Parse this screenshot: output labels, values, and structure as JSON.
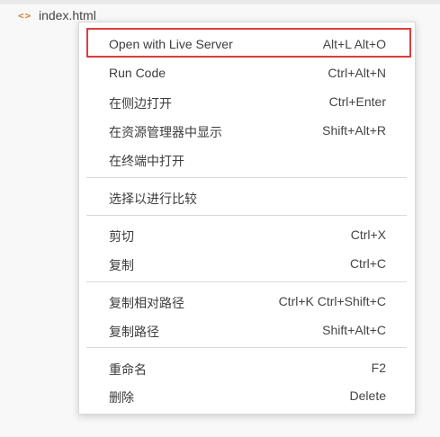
{
  "explorer": {
    "file_icon": "code-file-icon",
    "file_icon_glyph": "<>",
    "file_name": "index.html",
    "icon_color": "#e37933"
  },
  "context_menu": {
    "highlight_color": "#e03c3c",
    "items": [
      {
        "label": "Open with Live Server",
        "shortcut": "Alt+L Alt+O"
      },
      {
        "label": "Run Code",
        "shortcut": "Ctrl+Alt+N"
      },
      {
        "label": "在侧边打开",
        "shortcut": "Ctrl+Enter"
      },
      {
        "label": "在资源管理器中显示",
        "shortcut": "Shift+Alt+R"
      },
      {
        "label": "在终端中打开",
        "shortcut": ""
      },
      {
        "label": "选择以进行比较",
        "shortcut": ""
      },
      {
        "label": "剪切",
        "shortcut": "Ctrl+X"
      },
      {
        "label": "复制",
        "shortcut": "Ctrl+C"
      },
      {
        "label": "复制相对路径",
        "shortcut": "Ctrl+K Ctrl+Shift+C"
      },
      {
        "label": "复制路径",
        "shortcut": "Shift+Alt+C"
      },
      {
        "label": "重命名",
        "shortcut": "F2"
      },
      {
        "label": "删除",
        "shortcut": "Delete"
      }
    ]
  }
}
